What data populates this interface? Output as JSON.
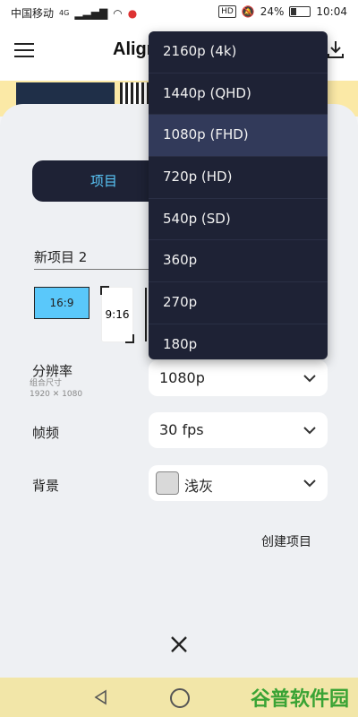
{
  "status": {
    "carrier": "中国移动",
    "network": "4G",
    "battery": "24%",
    "time": "10:04",
    "hd": "HD"
  },
  "header": {
    "title": "Align"
  },
  "tabs": {
    "project": "项目"
  },
  "form": {
    "project_name": "新项目 2",
    "ratio_16_9": "16:9",
    "ratio_9_16": "9:16",
    "resolution_label": "分辨率",
    "resolution_sub1": "组合尺寸",
    "resolution_sub2": "1920 ✕ 1080",
    "resolution_value": "1080p",
    "fps_label": "帧频",
    "fps_value": "30 fps",
    "background_label": "背景",
    "background_value": "浅灰",
    "background_color": "#d9d9d9",
    "create_button": "创建项目"
  },
  "dropdown": {
    "options": [
      "2160p (4k)",
      "1440p (QHD)",
      "1080p (FHD)",
      "720p (HD)",
      "540p (SD)",
      "360p",
      "270p",
      "180p"
    ],
    "selected_index": 2
  },
  "watermark": "谷普软件园",
  "colors": {
    "accent": "#5ac8fa",
    "panel_dark": "#1e2235"
  }
}
